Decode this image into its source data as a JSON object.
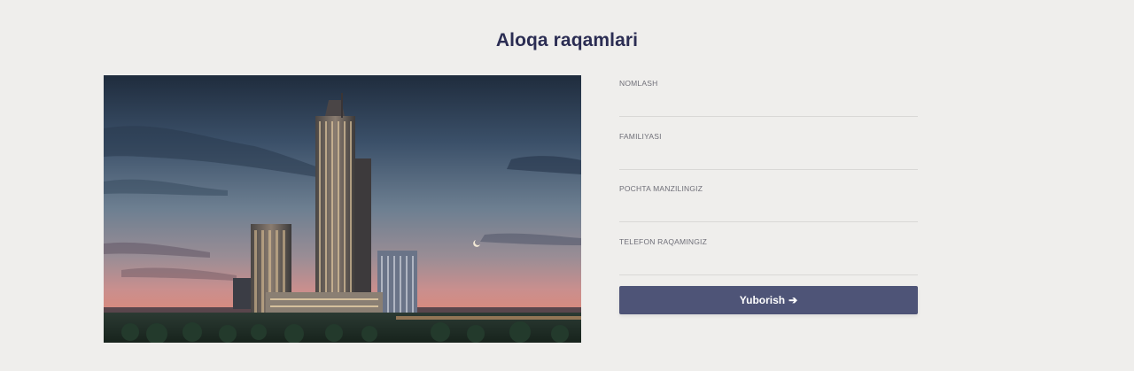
{
  "page_title": "Aloqa raqamlari",
  "image": {
    "icon": "building-photo"
  },
  "form": {
    "fields": [
      {
        "label": "NOMLASH",
        "value": ""
      },
      {
        "label": "FAMILIYASI",
        "value": ""
      },
      {
        "label": "POCHTA MANZILINGIZ",
        "value": ""
      },
      {
        "label": "TELEFON RAQAMINGIZ",
        "value": ""
      }
    ],
    "submit_label": "Yuborish",
    "submit_icon": "arrow-right-icon"
  },
  "colors": {
    "background": "#efeeec",
    "title": "#2b2d53",
    "button": "#4e5477",
    "divider": "#d9d8d6"
  }
}
